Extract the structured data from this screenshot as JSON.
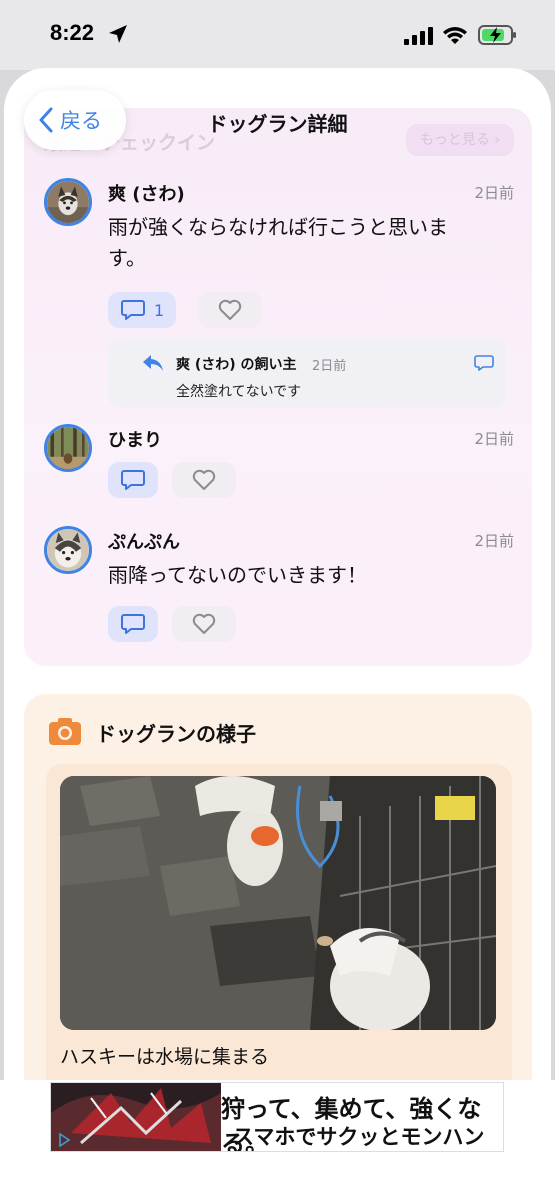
{
  "status_bar": {
    "time": "8:22"
  },
  "nav": {
    "title": "ドッグラン詳細",
    "back_label": "戻る"
  },
  "checkin_card": {
    "title": "最近のチェックイン",
    "more_label": "もっと見る ›",
    "comments": [
      {
        "name": "爽 (さわ)",
        "time": "2日前",
        "text": "雨が強くならなければ行こうと思います。",
        "reply_count": "1",
        "reply": {
          "name": "爽 (さわ) の飼い主",
          "time": "2日前",
          "text": "全然塗れてないです"
        }
      },
      {
        "name": "ひまり",
        "time": "2日前",
        "text": ""
      },
      {
        "name": "ぷんぷん",
        "time": "2日前",
        "text": "雨降ってないのでいきます！"
      }
    ]
  },
  "photo_card": {
    "title": "ドッグランの様子",
    "caption": "ハスキーは水場に集まる"
  },
  "ad": {
    "line1": "狩って、集めて、強くなる。",
    "line2": "スマホでサクッとモンハン"
  },
  "colors": {
    "accent": "#3f84e5",
    "checkin_bg": "#f7ebf7",
    "photo_bg": "#fdf1e6",
    "camera": "#ef8a3c"
  }
}
